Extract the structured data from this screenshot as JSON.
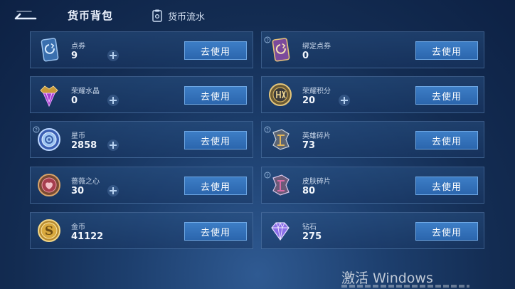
{
  "header": {
    "title": "货币背包",
    "flow_label": "货币流水",
    "back_icon": "back-arrow-icon",
    "flow_icon": "ledger-icon"
  },
  "cards": [
    {
      "name": "点券",
      "amount": "9",
      "button": "去使用",
      "has_plus": true,
      "has_help": false,
      "icon": "voucher-card-icon"
    },
    {
      "name": "绑定点券",
      "amount": "0",
      "button": "去使用",
      "has_plus": false,
      "has_help": true,
      "icon": "bound-voucher-card-icon"
    },
    {
      "name": "荣耀水晶",
      "amount": "0",
      "button": "去使用",
      "has_plus": true,
      "has_help": false,
      "icon": "glory-crystal-icon"
    },
    {
      "name": "荣耀积分",
      "amount": "20",
      "button": "去使用",
      "has_plus": true,
      "has_help": false,
      "icon": "glory-points-icon"
    },
    {
      "name": "星币",
      "amount": "2858",
      "button": "去使用",
      "has_plus": true,
      "has_help": true,
      "icon": "star-coin-icon"
    },
    {
      "name": "英雄碎片",
      "amount": "73",
      "button": "去使用",
      "has_plus": false,
      "has_help": true,
      "icon": "hero-fragment-icon"
    },
    {
      "name": "蔷薇之心",
      "amount": "30",
      "button": "去使用",
      "has_plus": true,
      "has_help": false,
      "icon": "rose-heart-icon"
    },
    {
      "name": "皮肤碎片",
      "amount": "80",
      "button": "去使用",
      "has_plus": false,
      "has_help": true,
      "icon": "skin-fragment-icon"
    },
    {
      "name": "金币",
      "amount": "41122",
      "button": "去使用",
      "has_plus": false,
      "has_help": false,
      "icon": "gold-coin-icon"
    },
    {
      "name": "钻石",
      "amount": "275",
      "button": "去使用",
      "has_plus": false,
      "has_help": false,
      "icon": "diamond-icon"
    }
  ],
  "watermark": {
    "text": "激活 Windows"
  },
  "colors": {
    "accent": "#3d7ec6",
    "card_border": "#78a0d2",
    "background": "#132c52"
  }
}
